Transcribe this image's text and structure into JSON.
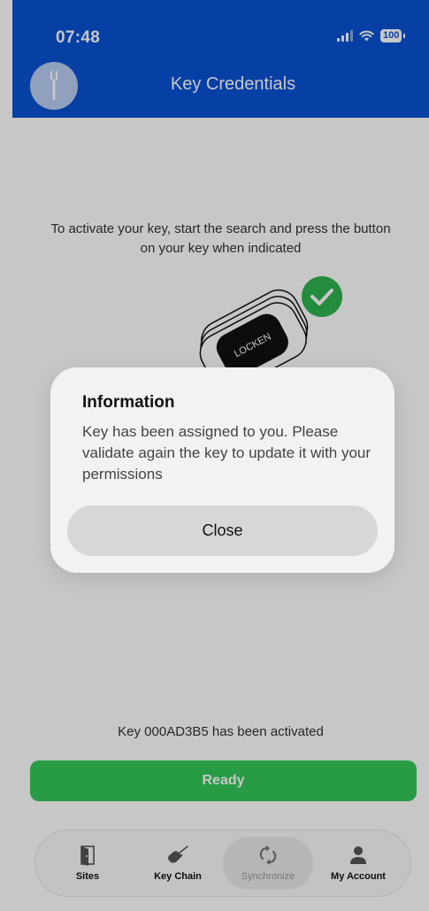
{
  "status_bar": {
    "time": "07:48",
    "battery": "100"
  },
  "header": {
    "title": "Key Credentials"
  },
  "main": {
    "instructions": "To activate your key, start the search and press the button on your key when indicated",
    "key_brand": "LOCKEN",
    "activation_message": "Key 000AD3B5 has been activated",
    "ready_button": "Ready"
  },
  "tabbar": {
    "tabs": [
      {
        "label": "Sites",
        "icon": "door-icon"
      },
      {
        "label": "Key Chain",
        "icon": "key-icon"
      },
      {
        "label": "Synchronize",
        "icon": "sync-icon",
        "active": true
      },
      {
        "label": "My Account",
        "icon": "person-icon"
      }
    ]
  },
  "dialog": {
    "title": "Information",
    "message": "Key has been assigned to you. Please validate again the key to update it with your permissions",
    "close_button": "Close"
  },
  "colors": {
    "header": "#0a52d4",
    "ready": "#34c759",
    "check": "#2fb44f"
  }
}
